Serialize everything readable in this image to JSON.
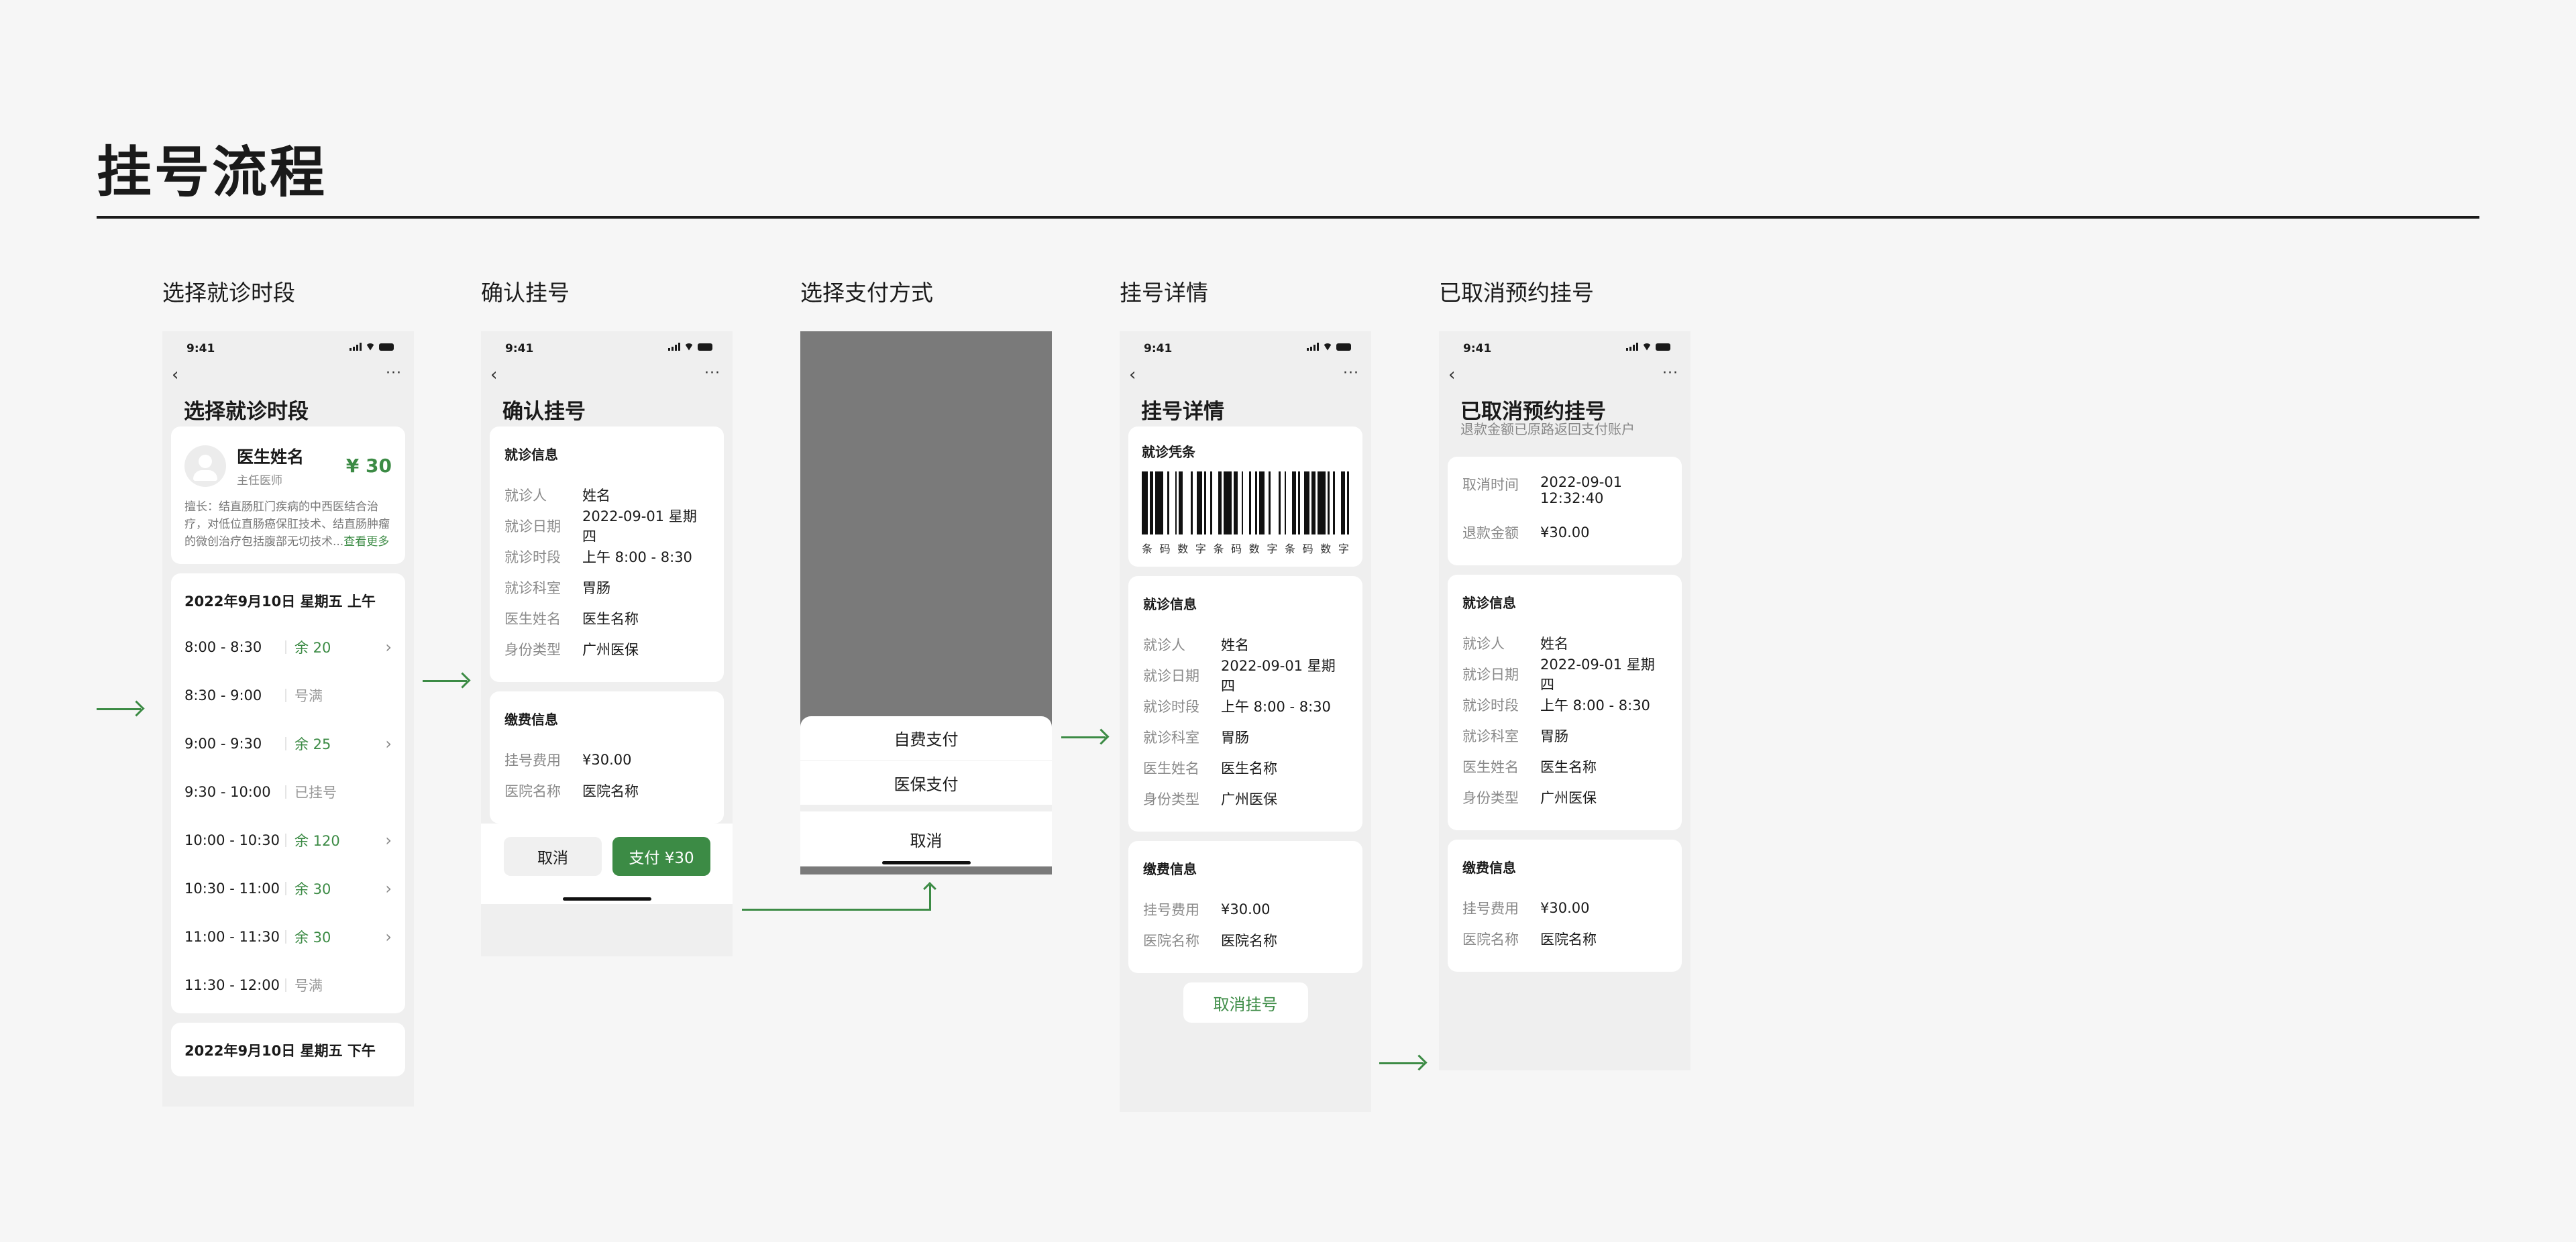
{
  "title": "挂号流程",
  "accent": "#3c8b45",
  "status_time": "9:41",
  "columns": [
    "选择就诊时段",
    "确认挂号",
    "选择支付方式",
    "挂号详情",
    "已取消预约挂号"
  ],
  "screen1": {
    "title": "选择就诊时段",
    "doctor_name": "医生姓名",
    "doctor_title": "主任医师",
    "price": "¥ 30",
    "desc": "擅长：结直肠肛门疾病的中西医结合治疗，对低位直肠癌保肛技术、结直肠肿瘤的微创治疗包括腹部无切技术...",
    "desc_link": "查看更多",
    "am_header": "2022年9月10日  星期五  上午",
    "pm_header": "2022年9月10日  星期五  下午",
    "slots": [
      {
        "time": "8:00 - 8:30",
        "status": "余 20"
      },
      {
        "time": "8:30 - 9:00",
        "status": "号满"
      },
      {
        "time": "9:00 - 9:30",
        "status": "余 25"
      },
      {
        "time": "9:30 - 10:00",
        "status": "已挂号"
      },
      {
        "time": "10:00 - 10:30",
        "status": "余 120"
      },
      {
        "time": "10:30 - 11:00",
        "status": "余 30"
      },
      {
        "time": "11:00 - 11:30",
        "status": "余 30"
      },
      {
        "time": "11:30 - 12:00",
        "status": "号满"
      }
    ]
  },
  "info": {
    "section": "就诊信息",
    "patient_k": "就诊人",
    "patient_v": "姓名",
    "date_k": "就诊日期",
    "date_v": "2022-09-01 星期四",
    "time_k": "就诊时段",
    "time_v": "上午 8:00 - 8:30",
    "dept_k": "就诊科室",
    "dept_v": "胃肠",
    "doc_k": "医生姓名",
    "doc_v": "医生名称",
    "type_k": "身份类型",
    "type_v": "广州医保"
  },
  "fee": {
    "section": "缴费信息",
    "fee_k": "挂号费用",
    "fee_v": "¥30.00",
    "hosp_k": "医院名称",
    "hosp_v": "医院名称"
  },
  "screen2": {
    "title": "确认挂号",
    "cancel": "取消",
    "pay": "支付 ¥30"
  },
  "screen3": {
    "opt1": "自费支付",
    "opt2": "医保支付",
    "cancel": "取消"
  },
  "screen4": {
    "title": "挂号详情",
    "voucher": "就诊凭条",
    "barcode_text": [
      "条",
      "码",
      "数",
      "字",
      "条",
      "码",
      "数",
      "字",
      "条",
      "码",
      "数",
      "字"
    ],
    "cancel_btn": "取消挂号"
  },
  "screen5": {
    "title": "已取消预约挂号",
    "subtitle": "退款金额已原路返回支付账户",
    "cancel_time_k": "取消时间",
    "cancel_time_v1": "2022-09-01",
    "cancel_time_v2": "12:32:40",
    "refund_k": "退款金额",
    "refund_v": "¥30.00"
  }
}
